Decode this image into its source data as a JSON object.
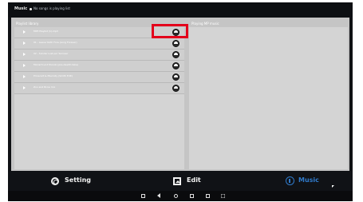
{
  "header": {
    "app_title": "Music",
    "now_playing": "No songs is playing list"
  },
  "library": {
    "title": "Playlist library",
    "tracks": [
      {
        "name": "MP3 Playlist (1).mp3"
      },
      {
        "name": "01 - Leave Yarth Fore (Long Forever)"
      },
      {
        "name": "02 - Sonder Lost por Sonraer"
      },
      {
        "name": "Moriarti und Mundo (pre-dearth take)"
      },
      {
        "name": "Pricecart & Mavrolly (Smith Edit)"
      },
      {
        "name": "Zoo and Brow mix"
      }
    ]
  },
  "playing": {
    "title": "Playing MP music"
  },
  "tabs": {
    "setting": "Setting",
    "edit": "Edit",
    "music": "Music"
  },
  "colors": {
    "screen_bg": "#0f1114",
    "content_bg": "#c5c5c5",
    "active_tab": "#2f79c9",
    "highlight": "#e3001b"
  },
  "icons": {
    "setting": "gear-icon",
    "edit": "image-icon",
    "music": "music-note-icon",
    "track": "play-arrow-icon",
    "track_action": "disc-icon"
  }
}
